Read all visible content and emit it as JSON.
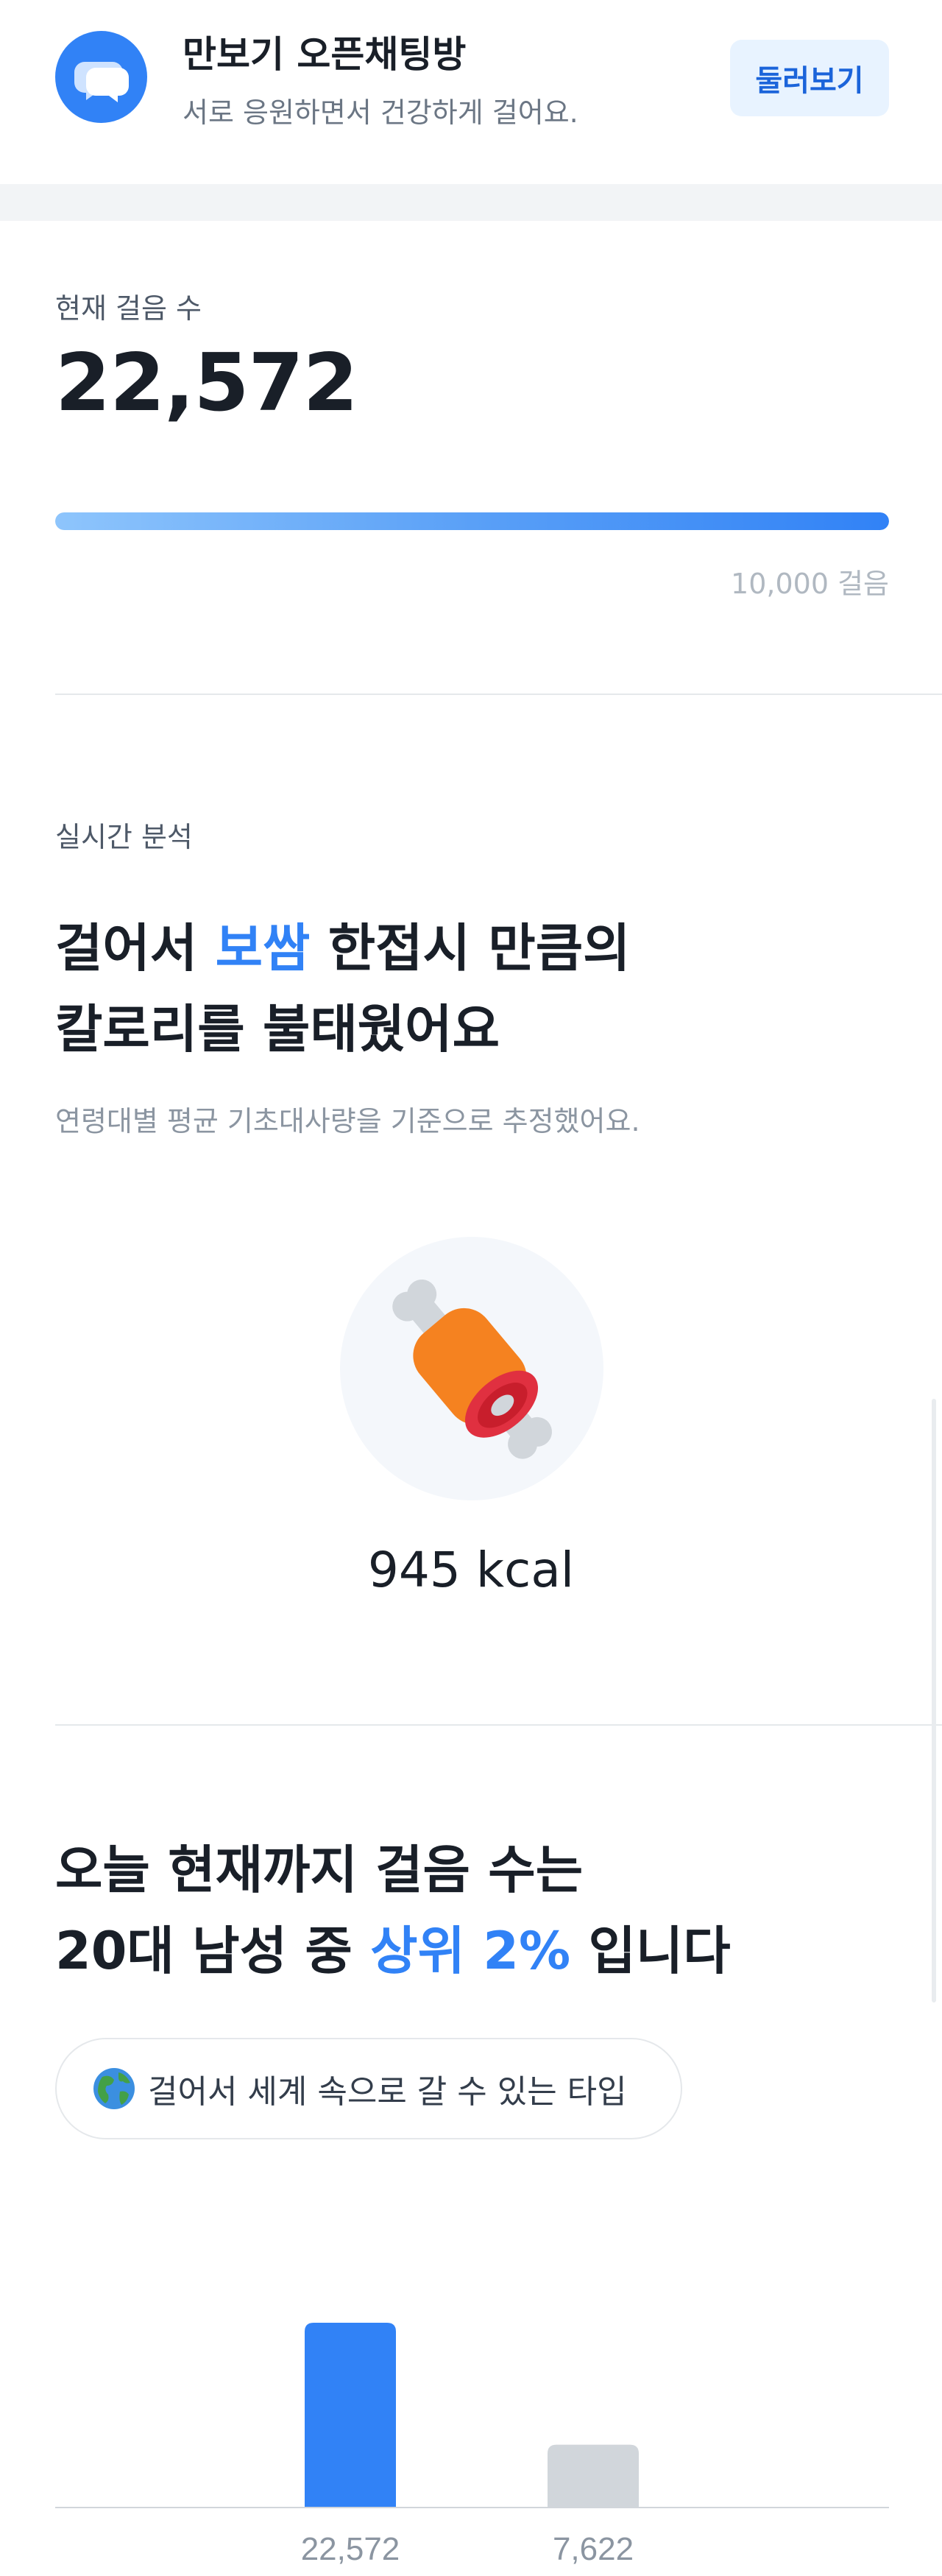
{
  "banner": {
    "icon": "chat-bubbles-icon",
    "title": "만보기 오픈채팅방",
    "subtitle": "서로 응원하면서 건강하게 걸어요.",
    "button_label": "둘러보기",
    "accent_color": "#3182f6"
  },
  "steps": {
    "label": "현재 걸음 수",
    "value": "22,572",
    "progress_fraction": 1.0,
    "goal_label": "10,000 걸음"
  },
  "calorie": {
    "section_label": "실시간 분석",
    "headline_part1": "걸어서 ",
    "headline_highlight": "보쌈",
    "headline_part2": " 한접시 만큼의",
    "headline_line2": "칼로리를 불태웠어요",
    "note": "연령대별 평균 기초대사량을 기준으로 추정했어요.",
    "food_icon": "meat-on-bone-icon",
    "kcal": "945 kcal"
  },
  "ranking": {
    "headline_line1": "오늘 현재까지 걸음 수는",
    "headline_part1": "20대 남성 중 ",
    "headline_highlight": "상위 2%",
    "headline_part2": " 입니다",
    "chip_icon": "globe-icon",
    "chip_label": "걸어서 세계 속으로 갈 수 있는 타입"
  },
  "chart_data": {
    "type": "bar",
    "categories": [
      "",
      ""
    ],
    "values": [
      22572,
      7622
    ],
    "tick_labels": [
      "22,572",
      "7,622"
    ],
    "colors": [
      "#3182f6",
      "#d1d6db"
    ],
    "title": "",
    "xlabel": "",
    "ylabel": "",
    "ylim": [
      0,
      22572
    ],
    "grid": false
  }
}
